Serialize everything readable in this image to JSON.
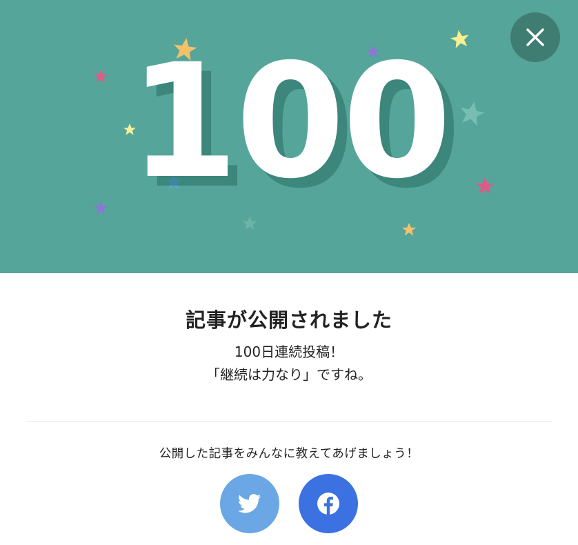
{
  "banner": {
    "milestone_number": "100",
    "background_color": "#56a59a",
    "close_icon": "close-icon"
  },
  "dialog": {
    "title": "記事が公開されました",
    "message_line1": "100日連続投稿！",
    "message_line2": "「継続は力なり」ですね。"
  },
  "share": {
    "prompt": "公開した記事をみんなに教えてあげましょう！",
    "buttons": [
      {
        "network": "twitter",
        "icon": "twitter-bird-icon",
        "color": "#6aa7e4"
      },
      {
        "network": "facebook",
        "icon": "facebook-f-icon",
        "color": "#3b71e0"
      }
    ]
  }
}
